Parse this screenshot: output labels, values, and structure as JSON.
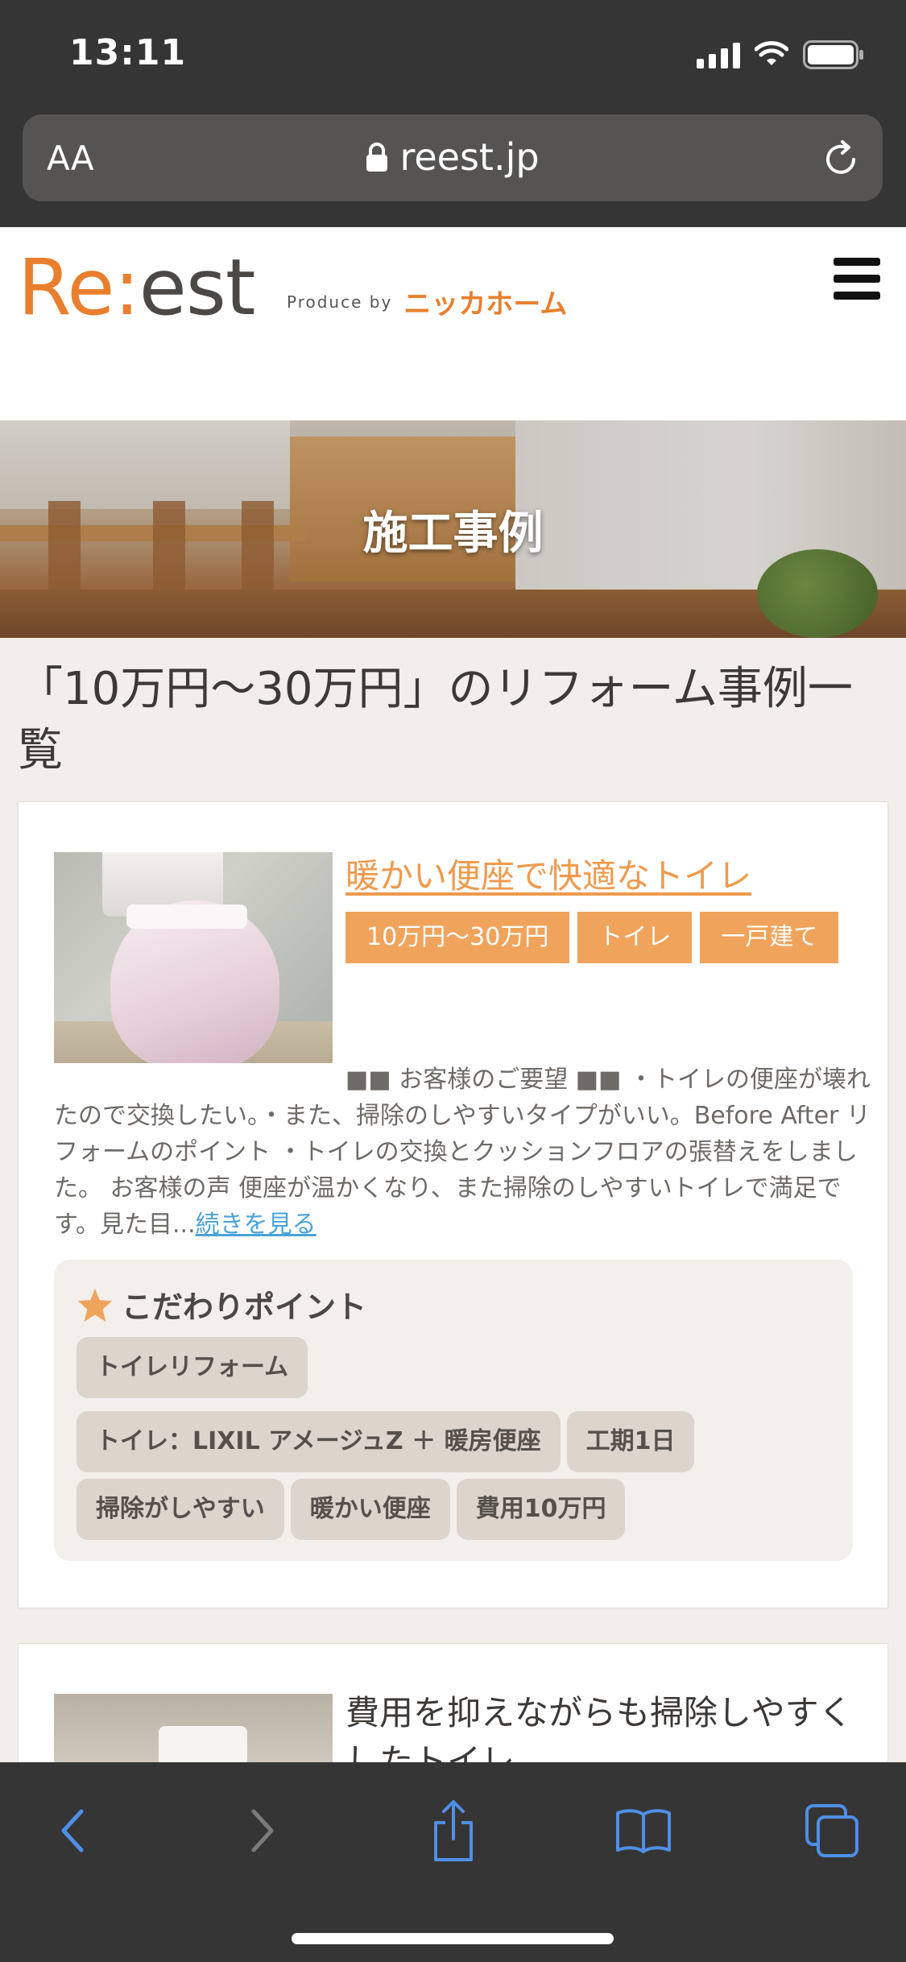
{
  "status_bar": {
    "time": "13:11"
  },
  "browser": {
    "aa_label": "AA",
    "url": "reest.jp"
  },
  "site": {
    "logo_re": "Re",
    "logo_colon": ":",
    "logo_est": "est",
    "produce_by": "Produce by",
    "maker": "ニッカホーム"
  },
  "hero": {
    "title": "施工事例"
  },
  "page_title": "「10万円〜30万円」のリフォーム事例一覧",
  "cases": [
    {
      "title": "暖かい便座で快適なトイレ",
      "tags": [
        "10万円〜30万円",
        "トイレ",
        "一戸建て"
      ],
      "excerpt": "■■ お客様のご要望 ■■ ・トイレの便座が壊れたので交換したい。・また、掃除のしやすいタイプがいい。Before After リフォームのポイント ・トイレの交換とクッションフロアの張替えをしました。 お客様の声 便座が温かくなり、また掃除のしやすいトイレで満足です。見た目...",
      "read_more": "続きを見る",
      "points_title": "こだわりポイント",
      "points": [
        "トイレリフォーム",
        "トイレ：LIXIL アメージュZ ＋ 暖房便座",
        "工期1日",
        "掃除がしやすい",
        "暖かい便座",
        "費用10万円"
      ]
    },
    {
      "title": "費用を抑えながらも掃除しやすくしたトイレ"
    }
  ],
  "colors": {
    "accent": "#f0a35a",
    "link": "#4aa3d8",
    "chrome": "#353535"
  }
}
